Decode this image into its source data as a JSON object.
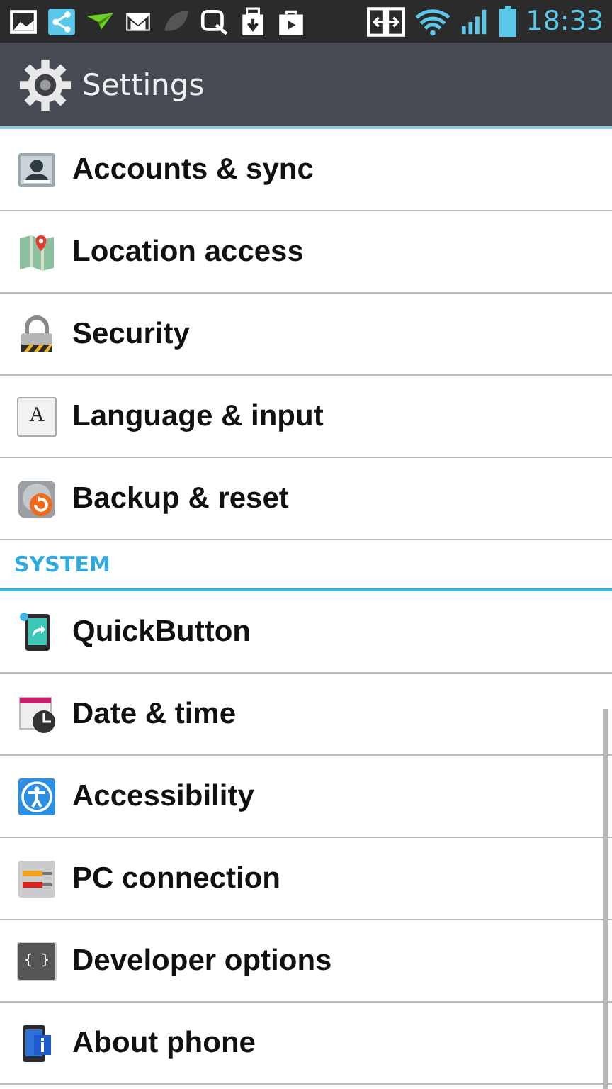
{
  "status_bar": {
    "notifications": [
      {
        "kind": "picture"
      },
      {
        "kind": "share"
      },
      {
        "kind": "paper-plane"
      },
      {
        "kind": "mail"
      },
      {
        "kind": "leaf"
      },
      {
        "kind": "search"
      },
      {
        "kind": "download"
      },
      {
        "kind": "bag"
      }
    ],
    "time": "18:33"
  },
  "header": {
    "title": "Settings"
  },
  "groups": [
    {
      "items": [
        {
          "label": "Accounts & sync",
          "kind": "account"
        },
        {
          "label": "Location access",
          "kind": "location"
        },
        {
          "label": "Security",
          "kind": "lock"
        },
        {
          "label": "Language & input",
          "kind": "language",
          "glyph": "A"
        },
        {
          "label": "Backup & reset",
          "kind": "backup"
        }
      ]
    },
    {
      "header": "SYSTEM",
      "items": [
        {
          "label": "QuickButton",
          "kind": "quick"
        },
        {
          "label": "Date & time",
          "kind": "datetime"
        },
        {
          "label": "Accessibility",
          "kind": "accessibility"
        },
        {
          "label": "PC connection",
          "kind": "pc"
        },
        {
          "label": "Developer options",
          "kind": "developer",
          "glyph": "{ }"
        },
        {
          "label": "About phone",
          "kind": "about"
        }
      ]
    }
  ]
}
